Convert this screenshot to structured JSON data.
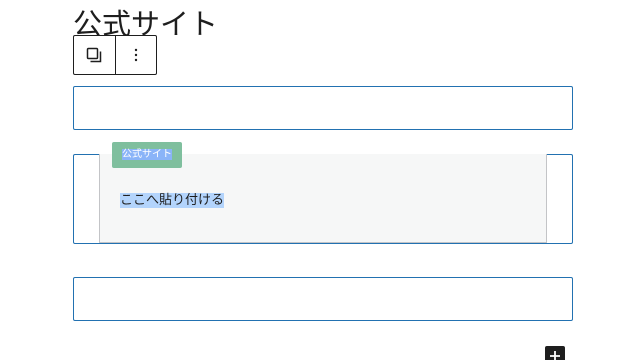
{
  "heading": {
    "text": "公式サイト"
  },
  "toolbar": {
    "items": [
      {
        "name": "duplicate",
        "icon": "duplicate-icon"
      },
      {
        "name": "options",
        "icon": "vertical-dots-icon"
      }
    ]
  },
  "blocks": [
    {
      "label": ""
    },
    {
      "tag": "公式サイト",
      "content": "ここへ貼り付ける"
    },
    {
      "label": ""
    }
  ],
  "inserter": {
    "icon": "plus-icon"
  },
  "colors": {
    "block_border": "#2271b1",
    "tag_background": "#7fbf9e",
    "text_selection": "#b3d4fc",
    "text": "#1e1e1e"
  }
}
